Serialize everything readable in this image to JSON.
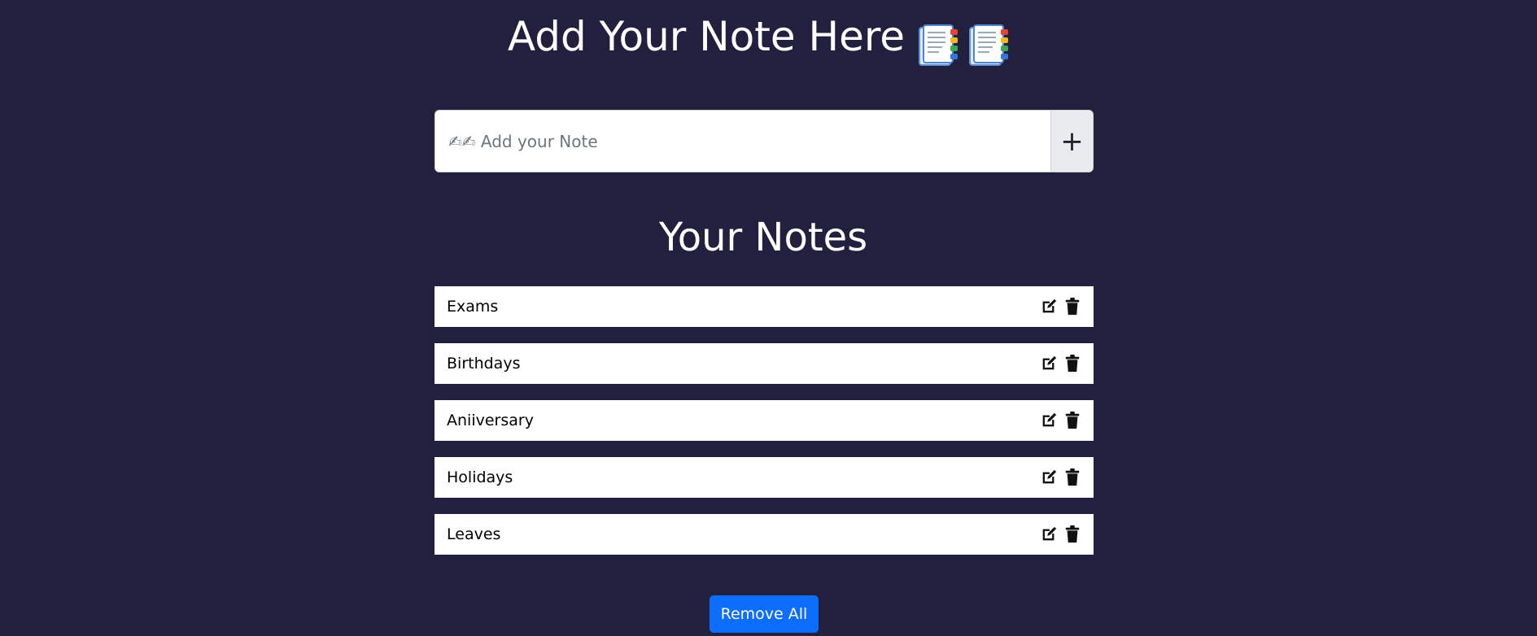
{
  "header": {
    "title": "Add Your Note Here"
  },
  "input": {
    "placeholder": "✍✍ Add your Note",
    "add_label": "+"
  },
  "notes_section": {
    "title": "Your Notes",
    "items": [
      {
        "label": "Exams"
      },
      {
        "label": "Birthdays"
      },
      {
        "label": "Aniiversary"
      },
      {
        "label": "Holidays"
      },
      {
        "label": "Leaves"
      }
    ]
  },
  "footer": {
    "remove_all_label": "Remove All"
  },
  "colors": {
    "background": "#221f3f",
    "primary": "#0d6efd",
    "text_light": "#ffffff"
  },
  "icons": {
    "title_icon": "bookmark-tabs-icon",
    "edit": "edit-icon",
    "delete": "trash-icon"
  }
}
